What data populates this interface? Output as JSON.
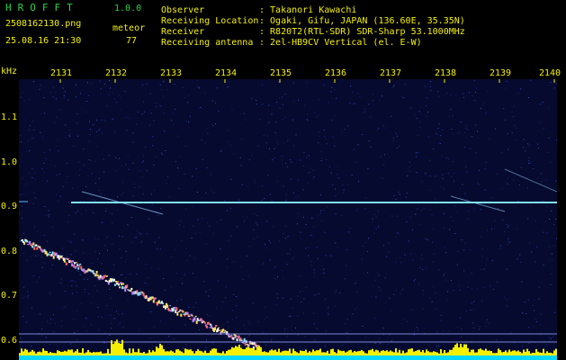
{
  "header": {
    "app_title": "HROFFT",
    "version": "1.0.0",
    "filename": "2508162130.png",
    "datetime": "25.08.16 21:30",
    "count_label": "meteor",
    "count_value": "77"
  },
  "info": [
    {
      "label": "Observer",
      "value": ": Takanori Kawachi"
    },
    {
      "label": "Receiving Location",
      "value": ": Ogaki, Gifu, JAPAN (136.60E, 35.35N)"
    },
    {
      "label": "Receiver",
      "value": ": R820T2(RTL-SDR) SDR-Sharp 53.1000MHz"
    },
    {
      "label": "Receiving antenna",
      "value": ": 2el-HB9CV Vertical (el. E-W)"
    }
  ],
  "spectrogram": {
    "y_unit": "kHz",
    "x_ticks": [
      "2131",
      "2132",
      "2133",
      "2134",
      "2135",
      "2136",
      "2137",
      "2138",
      "2139",
      "2140"
    ],
    "y_ticks": [
      "1.1",
      "1.0",
      "0.9",
      "0.8",
      "0.7",
      "0.6"
    ],
    "colors": {
      "background": "#060a2e",
      "noise": "#1c2a8a",
      "signal": "#7fe6ff",
      "bar": "#f4f000",
      "base": "#00d8ff"
    }
  }
}
